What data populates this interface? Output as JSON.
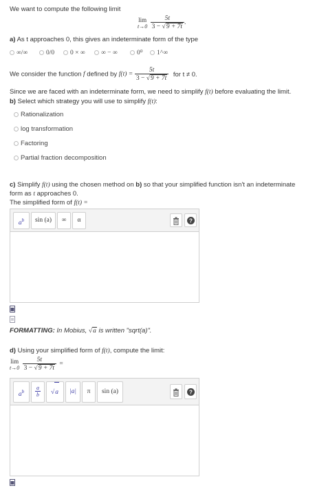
{
  "intro": "We want to compute the following limit",
  "limit": {
    "lim": "lim",
    "sub": "t→0",
    "num": "5t",
    "den_a": "3 − ",
    "den_rad": "9 + 7t",
    "end": "."
  },
  "part_a": {
    "label": "a)",
    "text": "As t approaches 0, this gives an indeterminate form of the type",
    "options": [
      "∞/∞",
      "0/0",
      "0 × ∞",
      "∞ − ∞",
      "0⁰",
      "1^∞"
    ]
  },
  "func_def": {
    "pre": "We consider the function ",
    "f": "f",
    "mid": " defined by ",
    "ft": "f(t) =",
    "num": "5t",
    "den_a": "3 − ",
    "den_rad": "9 + 7t",
    "cond": "for t ≠ 0."
  },
  "since": {
    "pre": "Since we are faced with an indeterminate form, we need to simplify ",
    "ft": "f(t)",
    "post": " before evaluating the limit."
  },
  "part_b": {
    "label": "b)",
    "text": "Select which strategy you will use to simplify ",
    "ft": "f(t)",
    "colon": ":",
    "options": [
      "Rationalization",
      "log transformation",
      "Factoring",
      "Partial fraction decomposition"
    ]
  },
  "part_c": {
    "label": "c)",
    "line1_pre": "Simplify ",
    "ft": "f(t)",
    "line1_mid": " using the chosen method on ",
    "b": "b)",
    "line1_post": " so that your simplified function isn't an indeterminate",
    "line2_pre": "form as ",
    "t": "t",
    "line2_post": " approaches 0.",
    "line3": "The simplified form of ",
    "ft2": "f(t) ="
  },
  "toolbar_c": {
    "b1": "a",
    "b1sup": "b",
    "b2": "sin (a)",
    "b3": "∞",
    "b4": "α"
  },
  "formatting": {
    "label": "FORMATTING:",
    "text": " In Mobius, ",
    "sqrt": "a",
    "post": " is written \"sqrt(a)\"."
  },
  "part_d": {
    "label": "d)",
    "pre": "Using your simplified form of ",
    "ft": "f(t)",
    "post": ", compute the limit:"
  },
  "limit_d": {
    "lim": "lim",
    "sub": "t→0",
    "num": "5t",
    "den_a": "3 − ",
    "den_rad": "9 + 7t",
    "eq": "="
  },
  "toolbar_d": {
    "b1": "a",
    "b1sup": "b",
    "b2n": "a",
    "b2d": "b",
    "b3": "a",
    "b4": "|a|",
    "b5": "π",
    "b6": "sin (a)"
  }
}
